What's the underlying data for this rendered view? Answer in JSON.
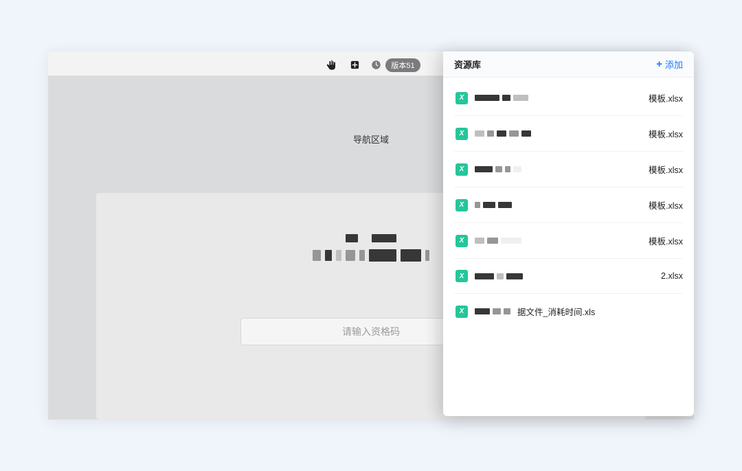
{
  "toolbar": {
    "version_label": "版本51"
  },
  "content": {
    "nav_label": "导航区域",
    "input_placeholder": "请输入资格码"
  },
  "panel": {
    "title": "资源库",
    "add_label": "添加"
  },
  "files": [
    {
      "suffix": "模板.xlsx"
    },
    {
      "suffix": "模板.xlsx"
    },
    {
      "suffix": "模板.xlsx"
    },
    {
      "suffix": "模板.xlsx"
    },
    {
      "suffix": "模板.xlsx"
    },
    {
      "suffix": "2.xlsx"
    },
    {
      "suffix": "据文件_消耗时间.xls"
    }
  ]
}
